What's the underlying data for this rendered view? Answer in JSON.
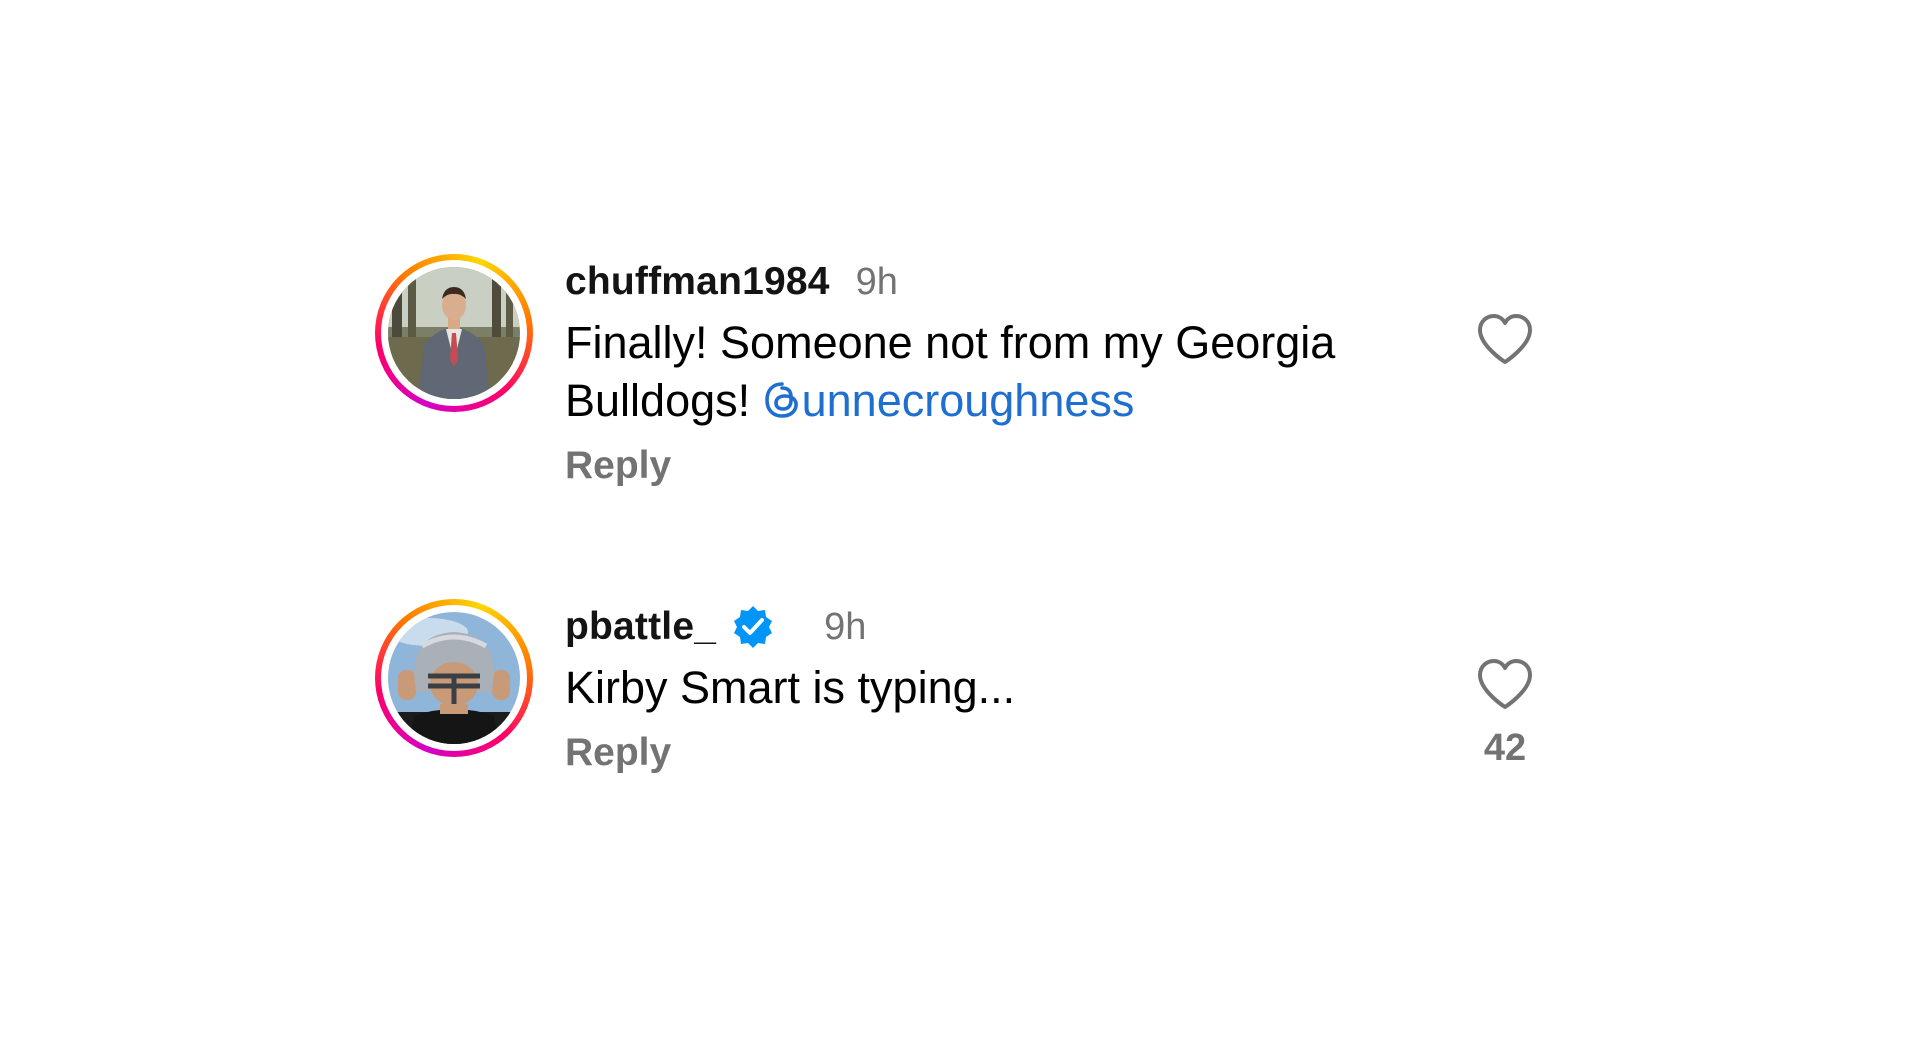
{
  "comments": [
    {
      "username": "chuffman1984",
      "verified": false,
      "time": "9h",
      "text": "Finally! Someone not from my Georgia Bulldogs! ",
      "mention": "unnecroughness",
      "reply_label": "Reply",
      "like_count": "",
      "avatar_icon": "profile-photo-man-in-suit"
    },
    {
      "username": "pbattle_",
      "verified": true,
      "time": "9h",
      "text": "Kirby Smart is typing...",
      "mention": "",
      "reply_label": "Reply",
      "like_count": "42",
      "avatar_icon": "profile-photo-football-helmet"
    }
  ],
  "colors": {
    "mention_blue": "#1e6fd0",
    "muted_gray": "#737373",
    "verified_blue": "#0095f6",
    "ring_gradient": [
      "#d300c5",
      "#ff0069",
      "#ff7a00",
      "#ffd600"
    ]
  },
  "icons": {
    "like": "heart-outline-icon",
    "verified": "verified-badge-icon",
    "mention_prefix": "threads-logo-icon"
  }
}
